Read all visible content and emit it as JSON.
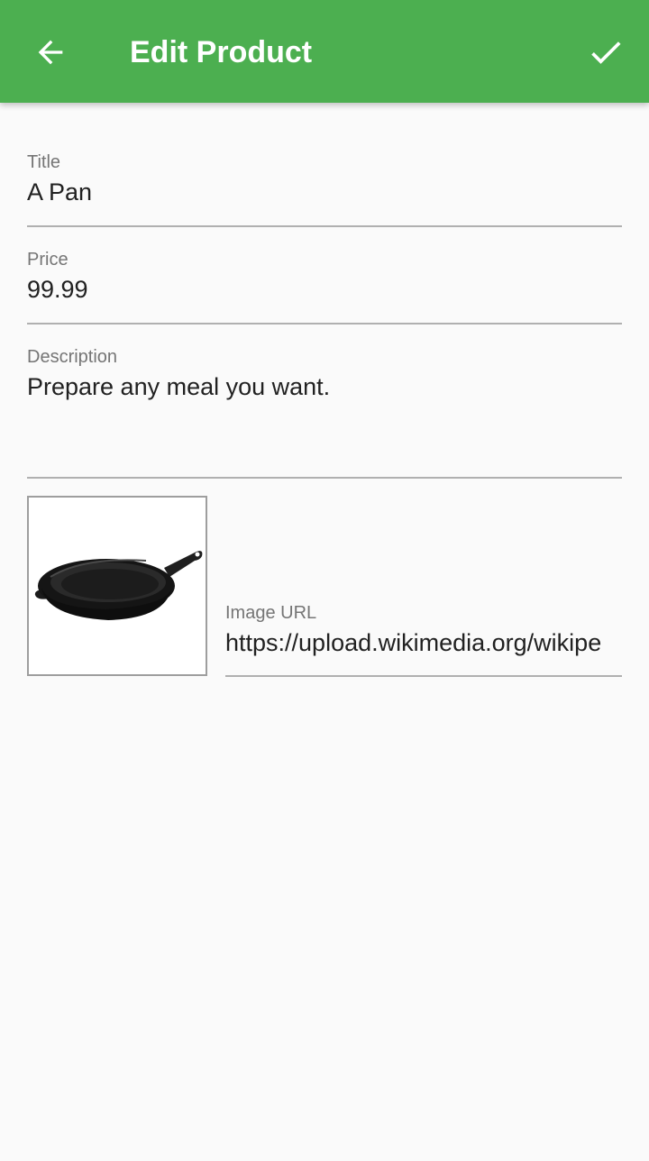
{
  "appbar": {
    "title": "Edit Product",
    "back_icon": "arrow-back-icon",
    "save_icon": "check-icon",
    "color": "#4caf50"
  },
  "form": {
    "title": {
      "label": "Title",
      "value": "A Pan"
    },
    "price": {
      "label": "Price",
      "value": "99.99"
    },
    "description": {
      "label": "Description",
      "value": "Prepare any meal you want."
    },
    "image_url": {
      "label": "Image URL",
      "value": "https://upload.wikimedia.org/wikipe"
    }
  },
  "image_preview": {
    "icon": "frying-pan-image"
  }
}
